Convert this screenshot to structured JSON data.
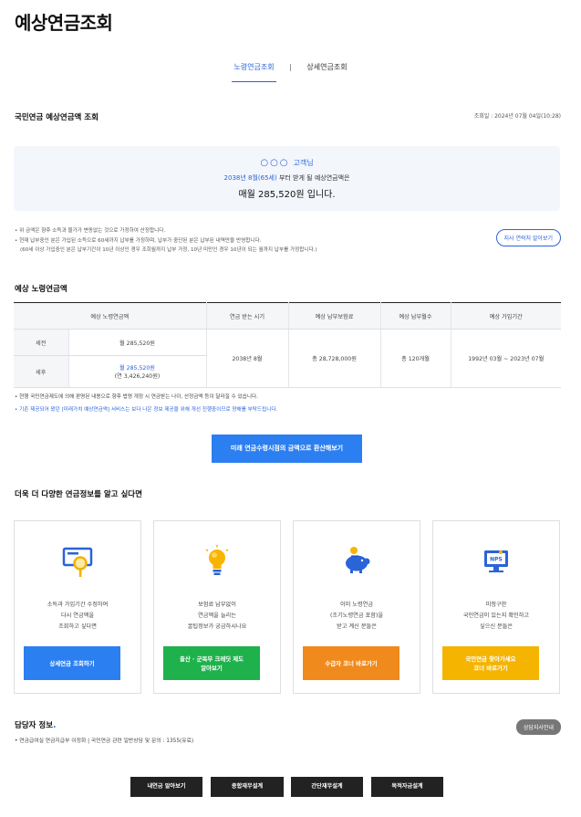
{
  "page": {
    "title": "예상연금조회"
  },
  "tabs": [
    {
      "label": "노령연금조회",
      "active": true
    },
    {
      "label": "상세연금조회",
      "active": false
    }
  ],
  "tab_separator": "|",
  "summary": {
    "title": "국민연금 예상연금액 조회",
    "inquiry_date": "조회일 : 2024년 07월 04일(10:28)",
    "customer_placeholder": "○○○",
    "customer_suffix": "고객님",
    "start_highlight": "2038년 8월(65세)",
    "start_suffix": "부터 받게 될 예상연금액은",
    "amount_text": "매월 285,520원 입니다."
  },
  "notes": [
    "• 위 금액은 향후 소득과 물가가 변동없는 것으로 가정하여 산정합니다.",
    "• 현재 납부중인 분은 가입된 소득으로 60세까지 납부를 가정하며, 납부가 중단된 분은 납부된 내역만을 반영합니다.",
    "(60세 이상 가입중인 분은 납부기간이 10년 이상인 경우 조회월까지 납부 가정, 10년 미만인 경우 10년이 되는 월까지 납부를 가정합니다.)"
  ],
  "branch_button": "지사 연락처 알아보기",
  "table_section": {
    "title": "예상 노령연금액",
    "headers": [
      "예상 노령연금액",
      "연금 받는 시기",
      "예상 납부보험료",
      "예상 납부월수",
      "예상 가입기간"
    ],
    "rows": [
      {
        "label": "세전",
        "amount": "월 285,520원",
        "annual": ""
      },
      {
        "label": "세후",
        "amount": "월 285,520원",
        "annual": "(연 3,426,240원)"
      }
    ],
    "start_time": "2038년 8월",
    "premium": "총 28,728,000원",
    "months": "총 120개월",
    "period": "1992년 03월 ~ 2023년 07월"
  },
  "notes2": [
    "• 현행 국민연금제도에 의해 판명된 내용으로 향후 법령 개정 시 연금받는 나이, 산정금액 등이 달라질 수 있습니다.",
    "• 기존 제공되어 왔던 [미래가치 예상연금액] 서비스는 보다 나은 정보 제공을 위해 개선 진행중이므로 양해를 부탁드립니다."
  ],
  "cta_button": "미래 연금수령시점의 금액으로 환산해보기",
  "more_section": {
    "title": "더욱 더 다양한 연금정보를 알고 싶다면"
  },
  "cards": [
    {
      "icon": "monitor-search-icon",
      "text": [
        "소득과 가입기간 수정하여",
        "다시 연금액을",
        "조회하고 싶다면"
      ],
      "button": [
        "상세연금 조회하기"
      ],
      "color": "#2b7ff0"
    },
    {
      "icon": "lightbulb-icon",
      "text": [
        "보험료 납부없이",
        "연금액을 늘리는",
        "꿀팁정보가 궁금하시나요"
      ],
      "button": [
        "출산 · 군복무 크레딧 제도",
        "알아보기"
      ],
      "color": "#1fb14c"
    },
    {
      "icon": "piggy-bank-icon",
      "text": [
        "이미 노령연금",
        "(조기노령연금 포함)을",
        "받고 계신 분들은"
      ],
      "button": [
        "수급자 코너 바로가기"
      ],
      "color": "#f08a1c"
    },
    {
      "icon": "nps-monitor-icon",
      "text": [
        "미청구한",
        "국민연금이 있는지 확인하고",
        "싶으신 분들은"
      ],
      "button": [
        "국민연금 찾아가세요",
        "코너 바로가기"
      ],
      "color": "#f5b400"
    }
  ],
  "staff": {
    "title": "담당자 정보",
    "dot": ".",
    "info": "• 연금급여실 연금지급부 이정화  |  국민연금 관련 일반상담 및 문의 : 1355(유료)",
    "button": "상담지사안내"
  },
  "bottom_buttons": [
    "내연금 알아보기",
    "종합재무설계",
    "간단재무설계",
    "목적자금설계"
  ]
}
